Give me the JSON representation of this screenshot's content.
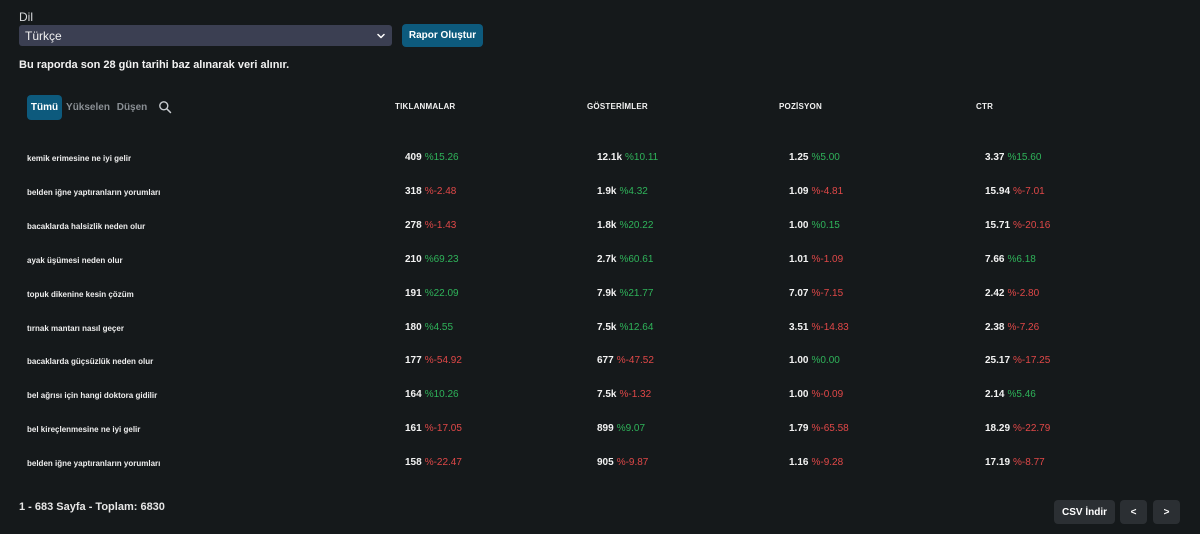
{
  "language": {
    "label": "Dil",
    "selected": "Türkçe"
  },
  "actions": {
    "generate_report": "Rapor Oluştur"
  },
  "info_text": "Bu raporda son 28 gün tarihi baz alınarak veri alınır.",
  "tabs": [
    {
      "label": "Tümü",
      "active": true
    },
    {
      "label": "Yükselen",
      "active": false
    },
    {
      "label": "Düşen",
      "active": false
    }
  ],
  "columns": {
    "clicks": "TIKLANMALAR",
    "impressions": "GÖSTERİMLER",
    "position": "POZİSYON",
    "ctr": "CTR"
  },
  "rows": [
    {
      "keyword": "kemik erimesine ne iyi gelir",
      "clicks": "409",
      "clicks_change": "%15.26",
      "impressions": "12.1k",
      "impressions_change": "%10.11",
      "position": "1.25",
      "position_change": "%5.00",
      "ctr": "3.37",
      "ctr_change": "%15.60"
    },
    {
      "keyword": "belden iğne yaptıranların yorumları",
      "clicks": "318",
      "clicks_change": "%-2.48",
      "impressions": "1.9k",
      "impressions_change": "%4.32",
      "position": "1.09",
      "position_change": "%-4.81",
      "ctr": "15.94",
      "ctr_change": "%-7.01"
    },
    {
      "keyword": "bacaklarda halsizlik neden olur",
      "clicks": "278",
      "clicks_change": "%-1.43",
      "impressions": "1.8k",
      "impressions_change": "%20.22",
      "position": "1.00",
      "position_change": "%0.15",
      "ctr": "15.71",
      "ctr_change": "%-20.16"
    },
    {
      "keyword": "ayak üşümesi neden olur",
      "clicks": "210",
      "clicks_change": "%69.23",
      "impressions": "2.7k",
      "impressions_change": "%60.61",
      "position": "1.01",
      "position_change": "%-1.09",
      "ctr": "7.66",
      "ctr_change": "%6.18"
    },
    {
      "keyword": "topuk dikenine kesin çözüm",
      "clicks": "191",
      "clicks_change": "%22.09",
      "impressions": "7.9k",
      "impressions_change": "%21.77",
      "position": "7.07",
      "position_change": "%-7.15",
      "ctr": "2.42",
      "ctr_change": "%-2.80"
    },
    {
      "keyword": "tırnak mantarı nasıl geçer",
      "clicks": "180",
      "clicks_change": "%4.55",
      "impressions": "7.5k",
      "impressions_change": "%12.64",
      "position": "3.51",
      "position_change": "%-14.83",
      "ctr": "2.38",
      "ctr_change": "%-7.26"
    },
    {
      "keyword": "bacaklarda güçsüzlük neden olur",
      "clicks": "177",
      "clicks_change": "%-54.92",
      "impressions": "677",
      "impressions_change": "%-47.52",
      "position": "1.00",
      "position_change": "%0.00",
      "ctr": "25.17",
      "ctr_change": "%-17.25"
    },
    {
      "keyword": "bel ağrısı için hangi doktora gidilir",
      "clicks": "164",
      "clicks_change": "%10.26",
      "impressions": "7.5k",
      "impressions_change": "%-1.32",
      "position": "1.00",
      "position_change": "%-0.09",
      "ctr": "2.14",
      "ctr_change": "%5.46"
    },
    {
      "keyword": "bel kireçlenmesine ne iyi gelir",
      "clicks": "161",
      "clicks_change": "%-17.05",
      "impressions": "899",
      "impressions_change": "%9.07",
      "position": "1.79",
      "position_change": "%-65.58",
      "ctr": "18.29",
      "ctr_change": "%-22.79"
    },
    {
      "keyword": "belden iğne yaptıranların yorumları",
      "clicks": "158",
      "clicks_change": "%-22.47",
      "impressions": "905",
      "impressions_change": "%-9.87",
      "position": "1.16",
      "position_change": "%-9.28",
      "ctr": "17.19",
      "ctr_change": "%-8.77"
    }
  ],
  "pagination": {
    "summary": "1 - 683 Sayfa - Toplam: 6830",
    "csv_label": "CSV İndir",
    "prev_label": "<",
    "next_label": ">"
  },
  "colors": {
    "positive": "#2fb35a",
    "negative": "#e04848",
    "accent": "#0d5a7d",
    "background": "#15191b"
  },
  "icons": {
    "search": "search-icon",
    "select_chevron": "chevron-down-icon"
  }
}
